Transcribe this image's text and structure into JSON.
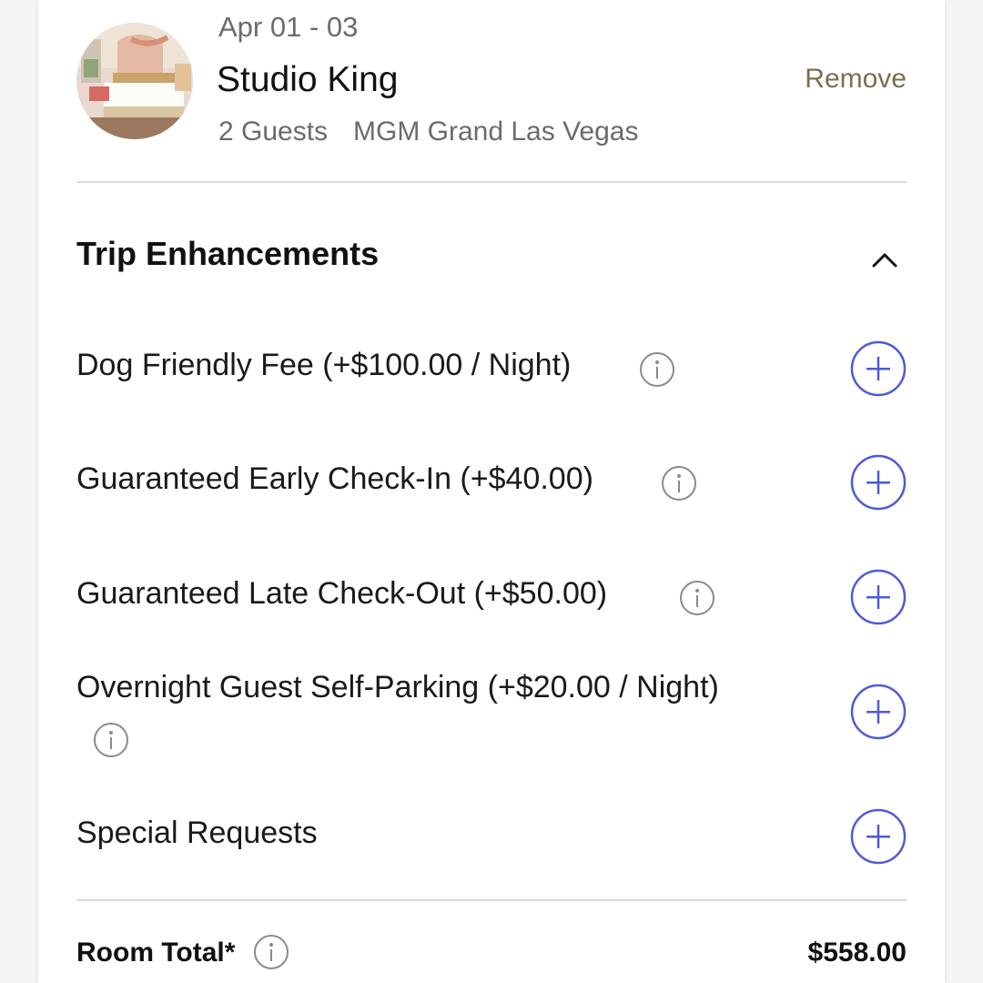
{
  "room": {
    "dates": "Apr 01 - 03",
    "name": "Studio King",
    "guests": "2 Guests",
    "hotel": "MGM Grand Las Vegas",
    "remove_label": "Remove"
  },
  "enhancements": {
    "title": "Trip Enhancements",
    "items": [
      {
        "label": "Dog Friendly Fee (+$100.00 / Night)"
      },
      {
        "label": "Guaranteed Early Check-In (+$40.00)"
      },
      {
        "label": "Guaranteed Late Check-Out (+$50.00)"
      },
      {
        "label": "Overnight Guest Self-Parking (+$20.00 / Night)"
      },
      {
        "label": "Special Requests"
      }
    ]
  },
  "total": {
    "label": "Room Total*",
    "value": "$558.00"
  },
  "colors": {
    "accent": "#4d5bd8",
    "remove": "#7a6f4e",
    "info": "#8a8a8a"
  },
  "icons": {
    "collapse": "chevron-up-icon",
    "info": "info-icon",
    "add": "plus-circle-icon"
  }
}
